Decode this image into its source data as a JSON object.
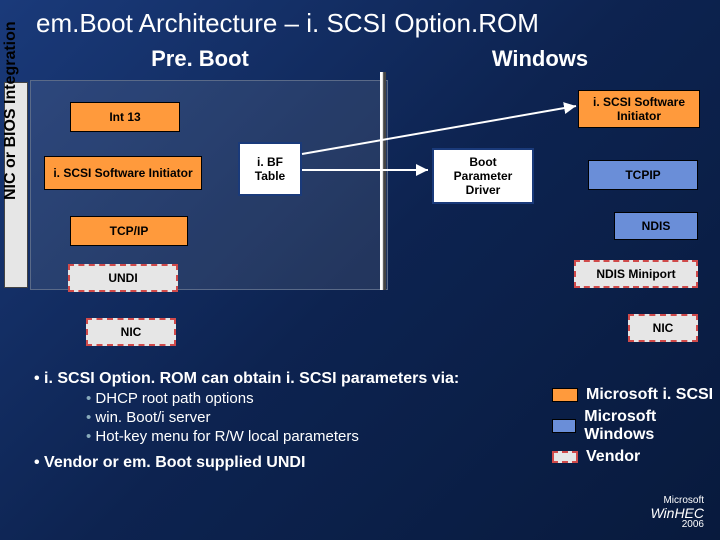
{
  "title": "em.Boot Architecture –  i. SCSI Option.ROM",
  "columns": {
    "left": "Pre. Boot",
    "right": "Windows"
  },
  "vlabel": "NIC or BIOS Integration",
  "boxes": {
    "int13": "Int 13",
    "init_l": "i. SCSI Software Initiator",
    "ibf": "i. BF\nTable",
    "tcpip_l": "TCP/IP",
    "undi": "UNDI",
    "nic_l": "NIC",
    "init_r": "i. SCSI Software Initiator",
    "bpd": "Boot\nParameter\nDriver",
    "tcpip_r": "TCPIP",
    "ndis": "NDIS",
    "miniport": "NDIS Miniport",
    "nic_r": "NIC"
  },
  "bullets": {
    "heading": "i. SCSI Option. ROM can obtain i. SCSI parameters via:",
    "items": [
      "DHCP root path options",
      "win. Boot/i server",
      "Hot-key menu for R/W local parameters"
    ],
    "tail": "Vendor or em. Boot supplied UNDI"
  },
  "legend": {
    "ms_iscsi": "Microsoft i. SCSI",
    "ms_win": "Microsoft Windows",
    "vendor": "Vendor"
  },
  "logo": {
    "brand": "Microsoft",
    "event": "WinHEC",
    "year": "2006"
  }
}
